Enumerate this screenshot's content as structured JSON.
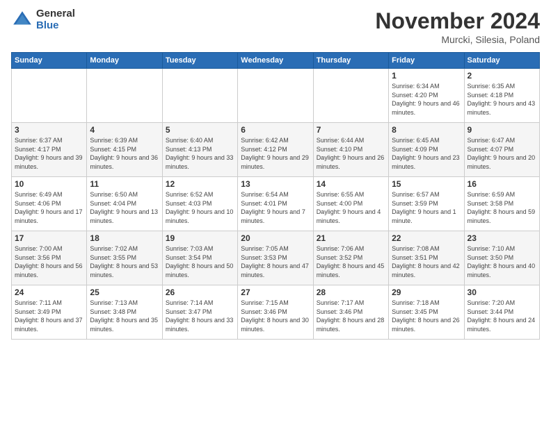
{
  "logo": {
    "general": "General",
    "blue": "Blue"
  },
  "title": "November 2024",
  "location": "Murcki, Silesia, Poland",
  "days_header": [
    "Sunday",
    "Monday",
    "Tuesday",
    "Wednesday",
    "Thursday",
    "Friday",
    "Saturday"
  ],
  "weeks": [
    [
      {
        "day": "",
        "info": ""
      },
      {
        "day": "",
        "info": ""
      },
      {
        "day": "",
        "info": ""
      },
      {
        "day": "",
        "info": ""
      },
      {
        "day": "",
        "info": ""
      },
      {
        "day": "1",
        "info": "Sunrise: 6:34 AM\nSunset: 4:20 PM\nDaylight: 9 hours and 46 minutes."
      },
      {
        "day": "2",
        "info": "Sunrise: 6:35 AM\nSunset: 4:18 PM\nDaylight: 9 hours and 43 minutes."
      }
    ],
    [
      {
        "day": "3",
        "info": "Sunrise: 6:37 AM\nSunset: 4:17 PM\nDaylight: 9 hours and 39 minutes."
      },
      {
        "day": "4",
        "info": "Sunrise: 6:39 AM\nSunset: 4:15 PM\nDaylight: 9 hours and 36 minutes."
      },
      {
        "day": "5",
        "info": "Sunrise: 6:40 AM\nSunset: 4:13 PM\nDaylight: 9 hours and 33 minutes."
      },
      {
        "day": "6",
        "info": "Sunrise: 6:42 AM\nSunset: 4:12 PM\nDaylight: 9 hours and 29 minutes."
      },
      {
        "day": "7",
        "info": "Sunrise: 6:44 AM\nSunset: 4:10 PM\nDaylight: 9 hours and 26 minutes."
      },
      {
        "day": "8",
        "info": "Sunrise: 6:45 AM\nSunset: 4:09 PM\nDaylight: 9 hours and 23 minutes."
      },
      {
        "day": "9",
        "info": "Sunrise: 6:47 AM\nSunset: 4:07 PM\nDaylight: 9 hours and 20 minutes."
      }
    ],
    [
      {
        "day": "10",
        "info": "Sunrise: 6:49 AM\nSunset: 4:06 PM\nDaylight: 9 hours and 17 minutes."
      },
      {
        "day": "11",
        "info": "Sunrise: 6:50 AM\nSunset: 4:04 PM\nDaylight: 9 hours and 13 minutes."
      },
      {
        "day": "12",
        "info": "Sunrise: 6:52 AM\nSunset: 4:03 PM\nDaylight: 9 hours and 10 minutes."
      },
      {
        "day": "13",
        "info": "Sunrise: 6:54 AM\nSunset: 4:01 PM\nDaylight: 9 hours and 7 minutes."
      },
      {
        "day": "14",
        "info": "Sunrise: 6:55 AM\nSunset: 4:00 PM\nDaylight: 9 hours and 4 minutes."
      },
      {
        "day": "15",
        "info": "Sunrise: 6:57 AM\nSunset: 3:59 PM\nDaylight: 9 hours and 1 minute."
      },
      {
        "day": "16",
        "info": "Sunrise: 6:59 AM\nSunset: 3:58 PM\nDaylight: 8 hours and 59 minutes."
      }
    ],
    [
      {
        "day": "17",
        "info": "Sunrise: 7:00 AM\nSunset: 3:56 PM\nDaylight: 8 hours and 56 minutes."
      },
      {
        "day": "18",
        "info": "Sunrise: 7:02 AM\nSunset: 3:55 PM\nDaylight: 8 hours and 53 minutes."
      },
      {
        "day": "19",
        "info": "Sunrise: 7:03 AM\nSunset: 3:54 PM\nDaylight: 8 hours and 50 minutes."
      },
      {
        "day": "20",
        "info": "Sunrise: 7:05 AM\nSunset: 3:53 PM\nDaylight: 8 hours and 47 minutes."
      },
      {
        "day": "21",
        "info": "Sunrise: 7:06 AM\nSunset: 3:52 PM\nDaylight: 8 hours and 45 minutes."
      },
      {
        "day": "22",
        "info": "Sunrise: 7:08 AM\nSunset: 3:51 PM\nDaylight: 8 hours and 42 minutes."
      },
      {
        "day": "23",
        "info": "Sunrise: 7:10 AM\nSunset: 3:50 PM\nDaylight: 8 hours and 40 minutes."
      }
    ],
    [
      {
        "day": "24",
        "info": "Sunrise: 7:11 AM\nSunset: 3:49 PM\nDaylight: 8 hours and 37 minutes."
      },
      {
        "day": "25",
        "info": "Sunrise: 7:13 AM\nSunset: 3:48 PM\nDaylight: 8 hours and 35 minutes."
      },
      {
        "day": "26",
        "info": "Sunrise: 7:14 AM\nSunset: 3:47 PM\nDaylight: 8 hours and 33 minutes."
      },
      {
        "day": "27",
        "info": "Sunrise: 7:15 AM\nSunset: 3:46 PM\nDaylight: 8 hours and 30 minutes."
      },
      {
        "day": "28",
        "info": "Sunrise: 7:17 AM\nSunset: 3:46 PM\nDaylight: 8 hours and 28 minutes."
      },
      {
        "day": "29",
        "info": "Sunrise: 7:18 AM\nSunset: 3:45 PM\nDaylight: 8 hours and 26 minutes."
      },
      {
        "day": "30",
        "info": "Sunrise: 7:20 AM\nSunset: 3:44 PM\nDaylight: 8 hours and 24 minutes."
      }
    ]
  ]
}
